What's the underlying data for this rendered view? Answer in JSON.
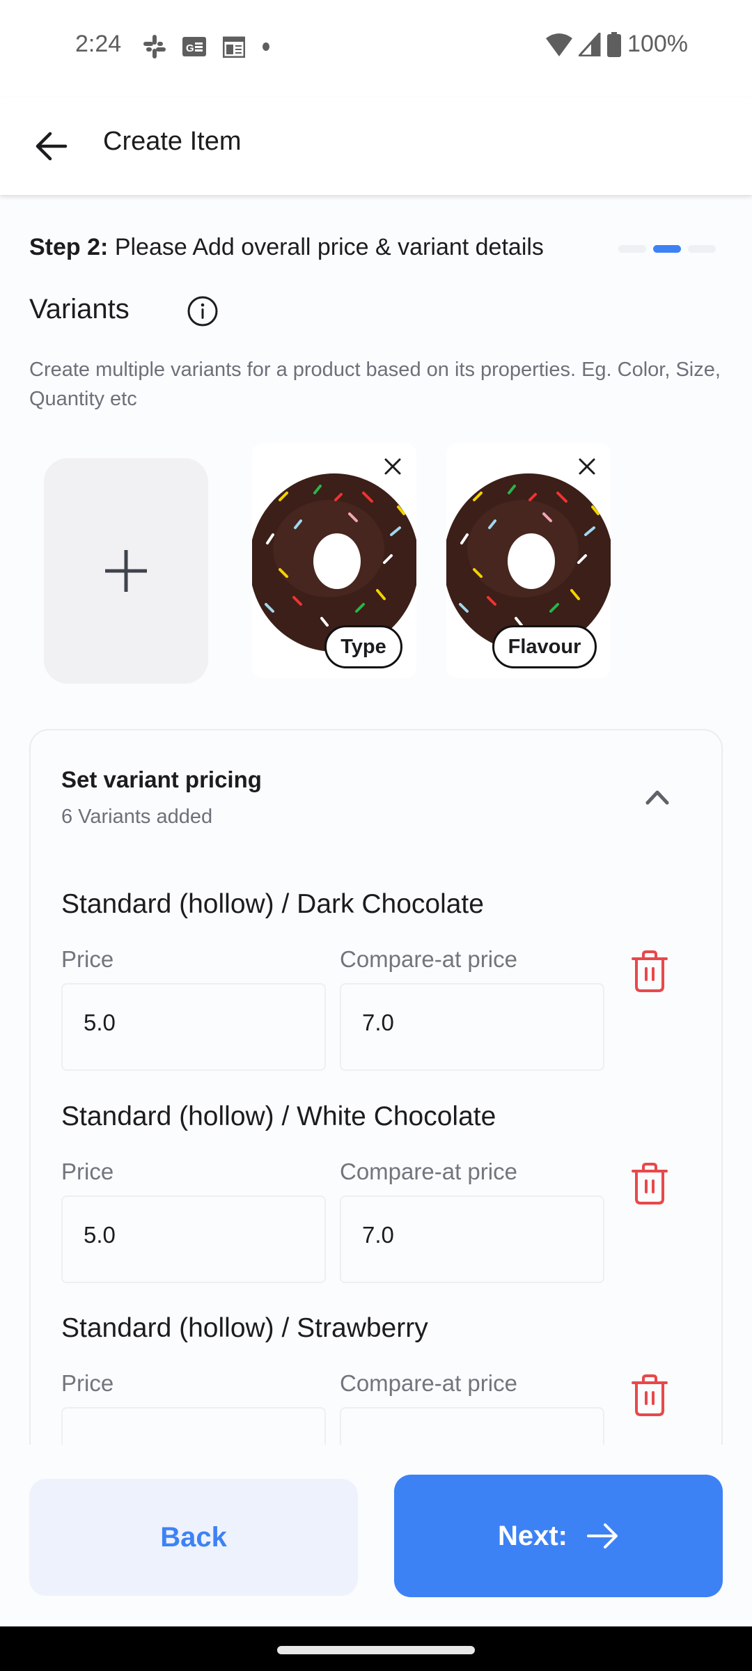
{
  "status_bar": {
    "time": "2:24",
    "left_icons": [
      "slack-icon",
      "news-icon",
      "calendar-icon",
      "dot-icon"
    ],
    "right_icons": [
      "wifi-icon",
      "signal-icon",
      "battery-icon"
    ],
    "battery_percent": "100%"
  },
  "app_bar": {
    "title": "Create Item",
    "back_icon": "arrow-left-icon"
  },
  "step": {
    "label": "Step 2:",
    "text": "Please Add overall price & variant details",
    "current": 2,
    "total": 3
  },
  "variants_section": {
    "title": "Variants",
    "description": "Create multiple variants for a product based on its properties. Eg. Color, Size, Quantity etc",
    "options": [
      {
        "label": "Type",
        "image": "chocolate-donut"
      },
      {
        "label": "Flavour",
        "image": "chocolate-donut"
      }
    ]
  },
  "pricing": {
    "title": "Set variant pricing",
    "subtitle": "6 Variants added",
    "price_label": "Price",
    "compare_label": "Compare-at price",
    "variants": [
      {
        "name": "Standard (hollow) / Dark Chocolate",
        "price": "5.0",
        "compare_at": "7.0"
      },
      {
        "name": "Standard (hollow) / White Chocolate",
        "price": "5.0",
        "compare_at": "7.0"
      },
      {
        "name": "Standard (hollow) / Strawberry",
        "price": "",
        "compare_at": ""
      }
    ]
  },
  "footer": {
    "back_label": "Back",
    "next_label": "Next:"
  },
  "colors": {
    "accent": "#3d82f5",
    "danger": "#e8484a",
    "back_button_bg": "#eef2fd"
  }
}
